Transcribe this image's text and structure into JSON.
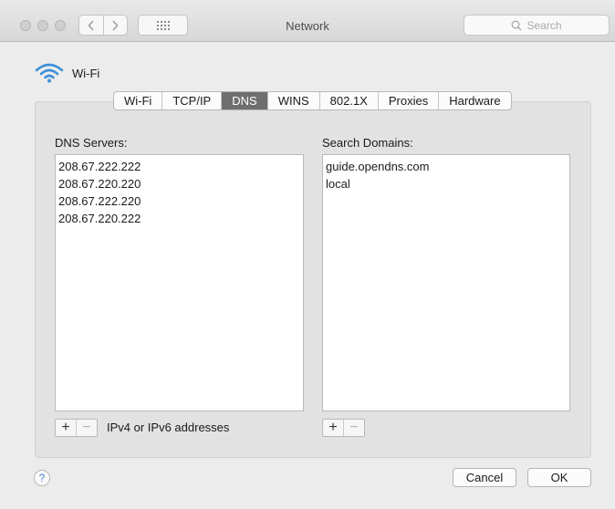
{
  "window": {
    "title": "Network"
  },
  "toolbar": {
    "search_placeholder": "Search"
  },
  "interface": {
    "name": "Wi-Fi"
  },
  "tabs": [
    {
      "label": "Wi-Fi",
      "active": false
    },
    {
      "label": "TCP/IP",
      "active": false
    },
    {
      "label": "DNS",
      "active": true
    },
    {
      "label": "WINS",
      "active": false
    },
    {
      "label": "802.1X",
      "active": false
    },
    {
      "label": "Proxies",
      "active": false
    },
    {
      "label": "Hardware",
      "active": false
    }
  ],
  "dns_servers": {
    "label": "DNS Servers:",
    "items": [
      "208.67.222.222",
      "208.67.220.220",
      "208.67.222.220",
      "208.67.220.222"
    ],
    "hint": "IPv4 or IPv6 addresses"
  },
  "search_domains": {
    "label": "Search Domains:",
    "items": [
      "guide.opendns.com",
      "local"
    ]
  },
  "buttons": {
    "plus": "+",
    "minus": "−",
    "help": "?",
    "cancel": "Cancel",
    "ok": "OK"
  },
  "colors": {
    "accent": "#4a90d9",
    "active_tab": "#6f6f6f"
  }
}
